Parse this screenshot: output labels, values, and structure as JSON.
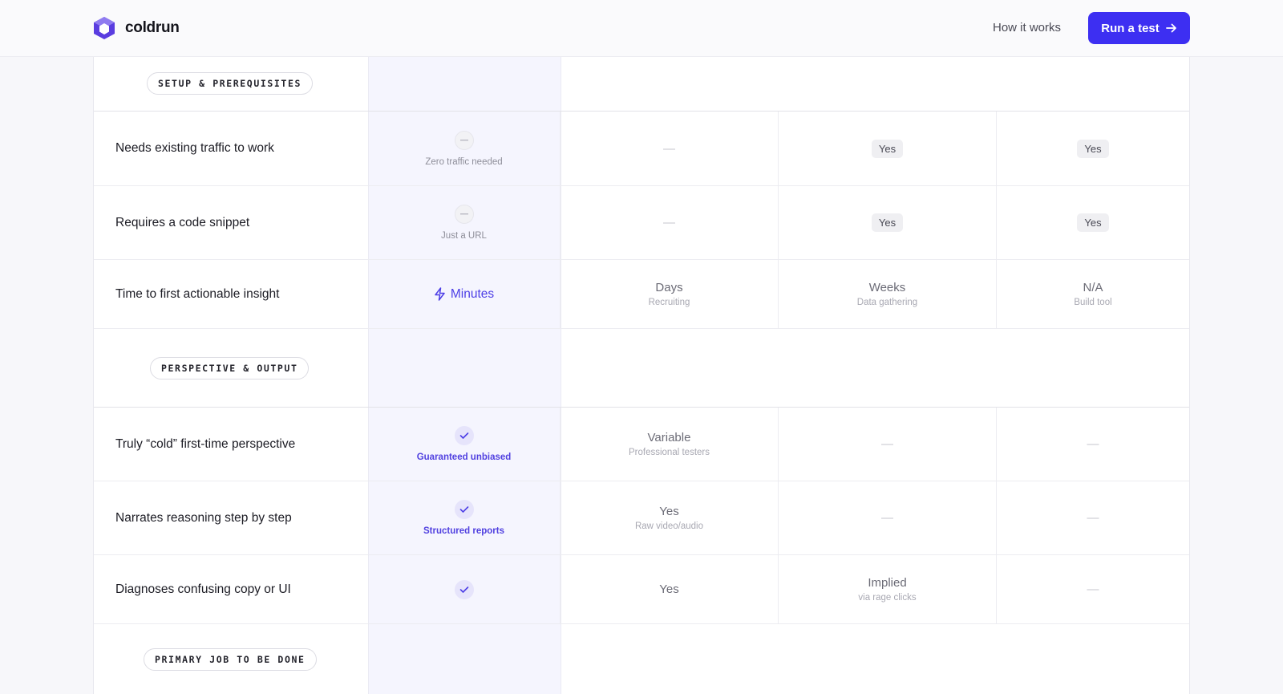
{
  "header": {
    "brand": "coldrun",
    "nav_link": "How it works",
    "cta_label": "Run a test",
    "accent": "#3d2ff2"
  },
  "sections": {
    "setup": "SETUP & PREREQUISITES",
    "perspective": "PERSPECTIVE & OUTPUT",
    "primary": "PRIMARY JOB TO BE DONE"
  },
  "rows": [
    {
      "label": "Needs existing traffic to work",
      "coldrun": {
        "icon": "minus-icon",
        "sub": "Zero traffic needed"
      },
      "col2": {
        "main": "—"
      },
      "col3": {
        "main": "Yes"
      },
      "col4": {
        "main": "Yes"
      }
    },
    {
      "label": "Requires a code snippet",
      "coldrun": {
        "icon": "minus-icon",
        "sub": "Just a URL"
      },
      "col2": {
        "main": "—"
      },
      "col3": {
        "main": "Yes"
      },
      "col4": {
        "main": "Yes"
      }
    },
    {
      "label": "Time to first actionable insight",
      "coldrun": {
        "icon": "lightning-icon",
        "main": "Minutes"
      },
      "col2": {
        "main": "Days",
        "sub": "Recruiting"
      },
      "col3": {
        "main": "Weeks",
        "sub": "Data gathering"
      },
      "col4": {
        "main": "N/A",
        "sub": "Build tool"
      }
    },
    {
      "label": "Truly “cold” first-time perspective",
      "coldrun": {
        "icon": "check-icon",
        "sub": "Guaranteed unbiased"
      },
      "col2": {
        "main": "Variable",
        "sub": "Professional testers"
      },
      "col3": {
        "main": "—"
      },
      "col4": {
        "main": "—"
      }
    },
    {
      "label": "Narrates reasoning step by step",
      "coldrun": {
        "icon": "check-icon",
        "sub": "Structured reports"
      },
      "col2": {
        "main": "Yes",
        "sub": "Raw video/audio"
      },
      "col3": {
        "main": "—"
      },
      "col4": {
        "main": "—"
      }
    },
    {
      "label": "Diagnoses confusing copy or UI",
      "coldrun": {
        "icon": "check-icon"
      },
      "col2": {
        "main": "Yes"
      },
      "col3": {
        "main": "Implied",
        "sub": "via rage clicks"
      },
      "col4": {
        "main": "—"
      }
    }
  ]
}
